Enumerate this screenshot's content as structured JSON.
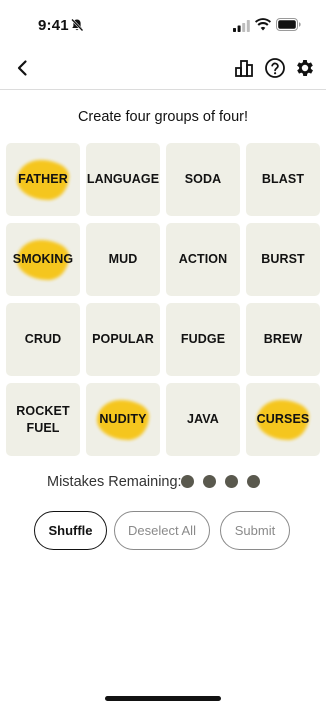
{
  "status_bar": {
    "time": "9:41"
  },
  "icons": {
    "back": "chevron-left-icon",
    "leaderboard": "bar-chart-icon",
    "help": "question-circle-icon",
    "settings": "gear-icon"
  },
  "instructions": "Create four groups of four!",
  "colors": {
    "tile_background": "#efefe6",
    "highlight": "#f6c414",
    "mistake_dot": "#5a594e",
    "text": "#121212"
  },
  "tiles": [
    {
      "word": "FATHER",
      "highlighted": true
    },
    {
      "word": "LANGUAGE",
      "highlighted": false
    },
    {
      "word": "SODA",
      "highlighted": false
    },
    {
      "word": "BLAST",
      "highlighted": false
    },
    {
      "word": "SMOKING",
      "highlighted": true
    },
    {
      "word": "MUD",
      "highlighted": false
    },
    {
      "word": "ACTION",
      "highlighted": false
    },
    {
      "word": "BURST",
      "highlighted": false
    },
    {
      "word": "CRUD",
      "highlighted": false
    },
    {
      "word": "POPULAR",
      "highlighted": false
    },
    {
      "word": "FUDGE",
      "highlighted": false
    },
    {
      "word": "BREW",
      "highlighted": false
    },
    {
      "word": "ROCKET FUEL",
      "highlighted": false
    },
    {
      "word": "NUDITY",
      "highlighted": true
    },
    {
      "word": "JAVA",
      "highlighted": false
    },
    {
      "word": "CURSES",
      "highlighted": true
    }
  ],
  "mistakes": {
    "label": "Mistakes Remaining:",
    "remaining": 4
  },
  "buttons": {
    "shuffle": "Shuffle",
    "deselect_all": "Deselect All",
    "submit": "Submit"
  }
}
